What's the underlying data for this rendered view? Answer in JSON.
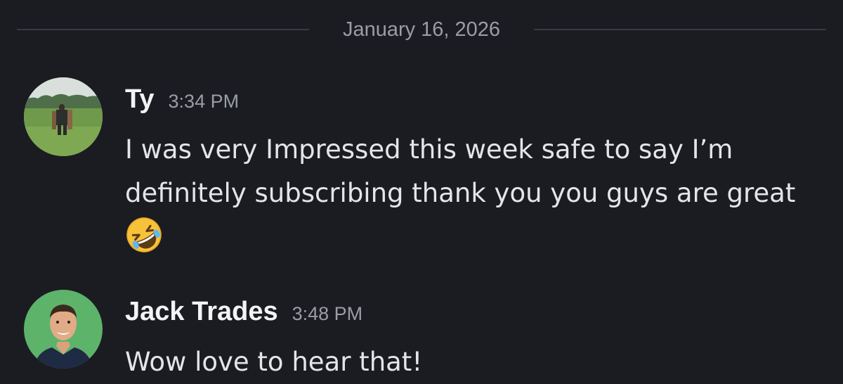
{
  "divider": {
    "date": "January 16, 2026"
  },
  "messages": [
    {
      "author": "Ty",
      "time": "3:34 PM",
      "text": "I was very Impressed this week safe to say I’m definitely subscribing thank you you guys are great",
      "emoji": "rolling-on-the-floor-laughing-emoji",
      "avatar": "avatar-field-photo"
    },
    {
      "author": "Jack Trades",
      "time": "3:48 PM",
      "text": "Wow love to hear that!",
      "avatar": "avatar-portrait-green-background"
    }
  ],
  "colors": {
    "background": "#1b1c21",
    "username": "#f2f3f5",
    "timestamp": "#9a9ca6",
    "message_text": "#e3e5e8",
    "divider_line": "#393b42",
    "avatar_green": "#5db36a"
  }
}
